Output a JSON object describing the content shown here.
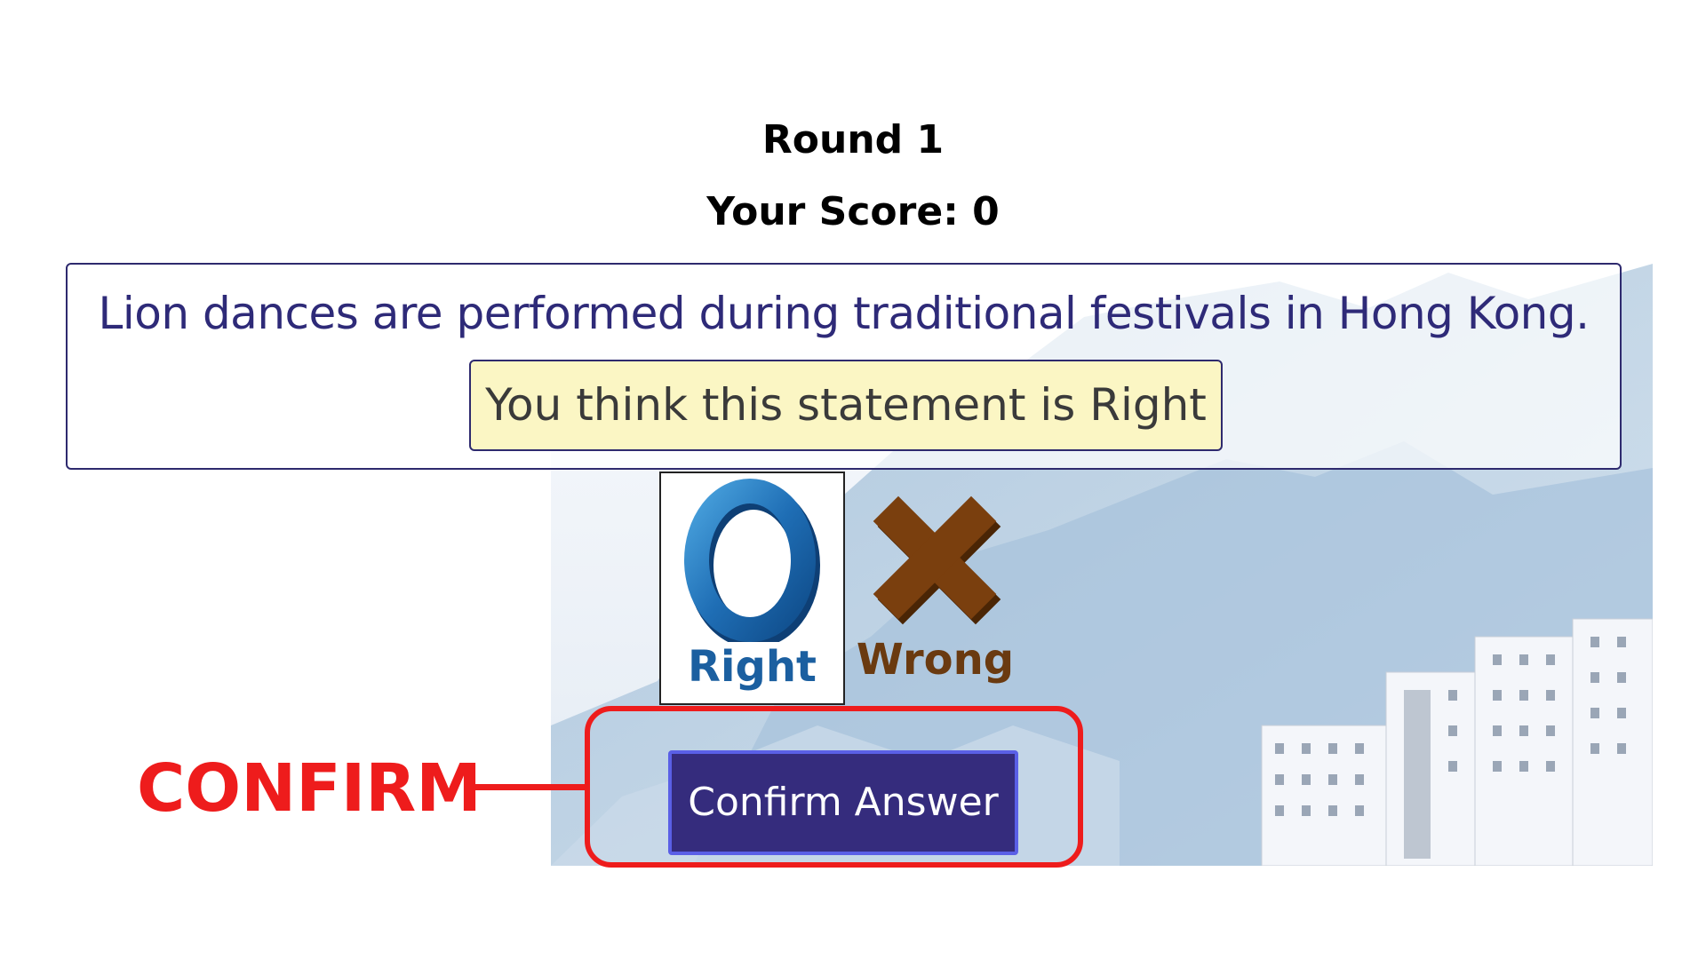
{
  "game": {
    "round_label": "Round 1",
    "score_label": "Your Score: 0"
  },
  "question": {
    "statement": "Lion dances are performed during traditional festivals in Hong Kong.",
    "selection_note": "You think this statement is Right"
  },
  "options": {
    "right": {
      "label": "Right",
      "icon": "circle-icon"
    },
    "wrong": {
      "label": "Wrong",
      "icon": "cross-icon"
    }
  },
  "actions": {
    "confirm_label": "Confirm Answer"
  },
  "annotation": {
    "callout_text": "CONFIRM",
    "color": "#ee1c1c"
  },
  "colors": {
    "text_blue": "#2e2a78",
    "button_bg": "#352c7d",
    "note_bg": "#fbf6c4"
  }
}
